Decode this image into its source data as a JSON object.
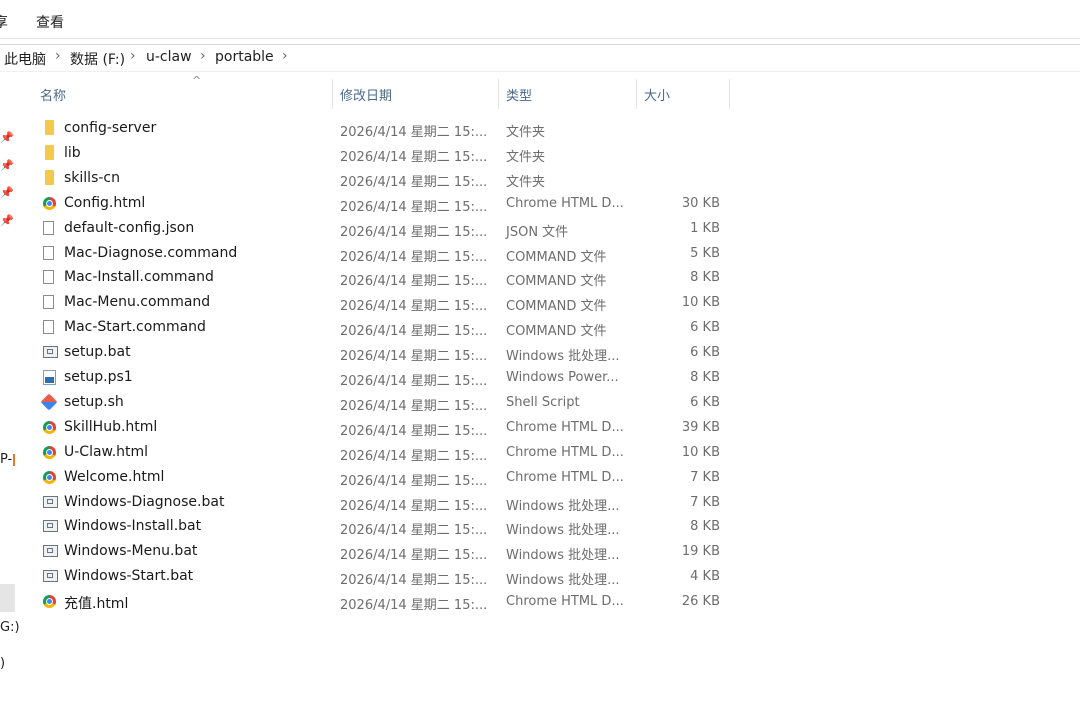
{
  "ribbon": {
    "cut_tab": "享",
    "view_tab": "查看"
  },
  "breadcrumb": [
    "此电脑",
    "数据 (F:)",
    "u-claw",
    "portable"
  ],
  "nav_fragments": {
    "a": "P-",
    "b": "G:)",
    "c": ")"
  },
  "columns": {
    "name": "名称",
    "date": "修改日期",
    "type": "类型",
    "size": "大小"
  },
  "files": [
    {
      "name": "config-server",
      "date": "2026/4/14 星期二 15:...",
      "type": "文件夹",
      "size": "",
      "icon": "folder-icon"
    },
    {
      "name": "lib",
      "date": "2026/4/14 星期二 15:...",
      "type": "文件夹",
      "size": "",
      "icon": "folder-icon"
    },
    {
      "name": "skills-cn",
      "date": "2026/4/14 星期二 15:...",
      "type": "文件夹",
      "size": "",
      "icon": "folder-icon"
    },
    {
      "name": "Config.html",
      "date": "2026/4/14 星期二 15:...",
      "type": "Chrome HTML D...",
      "size": "30 KB",
      "icon": "chrome-icon"
    },
    {
      "name": "default-config.json",
      "date": "2026/4/14 星期二 15:...",
      "type": "JSON 文件",
      "size": "1 KB",
      "icon": "document-icon"
    },
    {
      "name": "Mac-Diagnose.command",
      "date": "2026/4/14 星期二 15:...",
      "type": "COMMAND 文件",
      "size": "5 KB",
      "icon": "document-icon"
    },
    {
      "name": "Mac-Install.command",
      "date": "2026/4/14 星期二 15:...",
      "type": "COMMAND 文件",
      "size": "8 KB",
      "icon": "document-icon"
    },
    {
      "name": "Mac-Menu.command",
      "date": "2026/4/14 星期二 15:...",
      "type": "COMMAND 文件",
      "size": "10 KB",
      "icon": "document-icon"
    },
    {
      "name": "Mac-Start.command",
      "date": "2026/4/14 星期二 15:...",
      "type": "COMMAND 文件",
      "size": "6 KB",
      "icon": "document-icon"
    },
    {
      "name": "setup.bat",
      "date": "2026/4/14 星期二 15:...",
      "type": "Windows 批处理...",
      "size": "6 KB",
      "icon": "batch-file-icon"
    },
    {
      "name": "setup.ps1",
      "date": "2026/4/14 星期二 15:...",
      "type": "Windows Power...",
      "size": "8 KB",
      "icon": "powershell-icon"
    },
    {
      "name": "setup.sh",
      "date": "2026/4/14 星期二 15:...",
      "type": "Shell Script",
      "size": "6 KB",
      "icon": "shell-script-icon"
    },
    {
      "name": "SkillHub.html",
      "date": "2026/4/14 星期二 15:...",
      "type": "Chrome HTML D...",
      "size": "39 KB",
      "icon": "chrome-icon"
    },
    {
      "name": "U-Claw.html",
      "date": "2026/4/14 星期二 15:...",
      "type": "Chrome HTML D...",
      "size": "10 KB",
      "icon": "chrome-icon"
    },
    {
      "name": "Welcome.html",
      "date": "2026/4/14 星期二 15:...",
      "type": "Chrome HTML D...",
      "size": "7 KB",
      "icon": "chrome-icon"
    },
    {
      "name": "Windows-Diagnose.bat",
      "date": "2026/4/14 星期二 15:...",
      "type": "Windows 批处理...",
      "size": "7 KB",
      "icon": "batch-file-icon"
    },
    {
      "name": "Windows-Install.bat",
      "date": "2026/4/14 星期二 15:...",
      "type": "Windows 批处理...",
      "size": "8 KB",
      "icon": "batch-file-icon"
    },
    {
      "name": "Windows-Menu.bat",
      "date": "2026/4/14 星期二 15:...",
      "type": "Windows 批处理...",
      "size": "19 KB",
      "icon": "batch-file-icon"
    },
    {
      "name": "Windows-Start.bat",
      "date": "2026/4/14 星期二 15:...",
      "type": "Windows 批处理...",
      "size": "4 KB",
      "icon": "batch-file-icon"
    },
    {
      "name": "充值.html",
      "date": "2026/4/14 星期二 15:...",
      "type": "Chrome HTML D...",
      "size": "26 KB",
      "icon": "chrome-icon"
    }
  ],
  "colors": {
    "header_text": "#4a6a8a",
    "meta_text": "#6d6d6d",
    "folder": "#f2c94c"
  }
}
